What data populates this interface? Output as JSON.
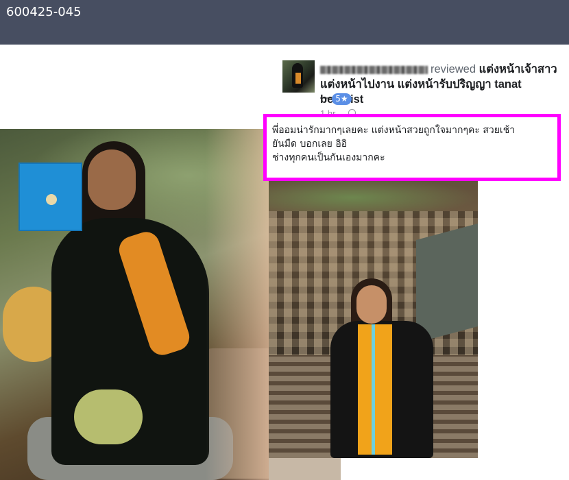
{
  "header": {
    "image_id": "600425-045"
  },
  "review": {
    "action": "reviewed",
    "business": "แต่งหน้าเจ้าสาว แต่งหน้าไปงาน แต่งหน้ารับปริญญา tanat beautist",
    "dash": "—",
    "rating": "5★",
    "time": "1 hr"
  },
  "comment": {
    "line1": "พี่ออมน่ารักมากๆเลยคะ แต่งหน้าสวยถูกใจมากๆคะ สวยเช้า",
    "line2": "ยันมืด บอกเลย อิอิ",
    "line3": "ช่างทุกคนเป็นกันเองมากคะ"
  },
  "colors": {
    "topbar": "#474e61",
    "highlight": "#ff00ff",
    "rating_badge": "#5b8fe6"
  }
}
